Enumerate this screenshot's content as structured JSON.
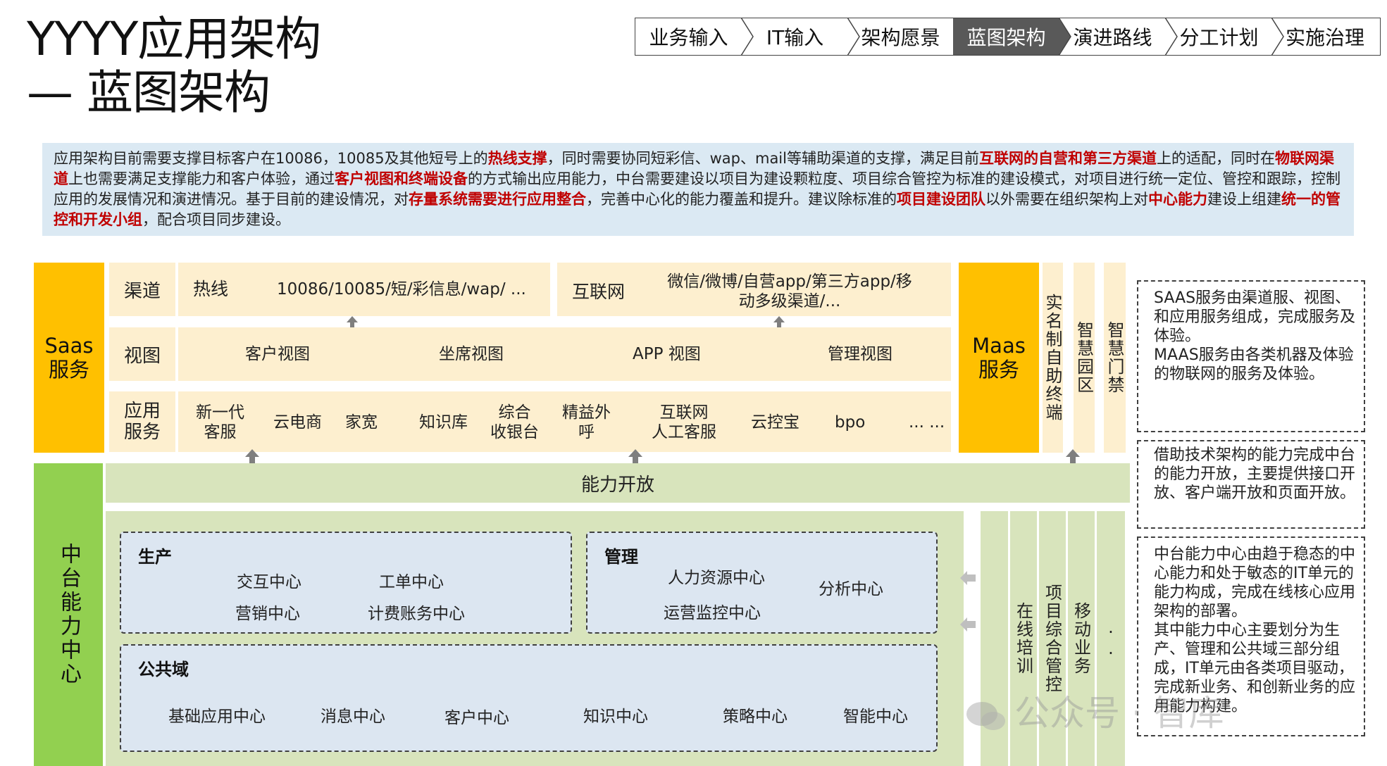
{
  "title": {
    "line1": "YYYY应用架构",
    "line2": "— 蓝图架构"
  },
  "breadcrumb": [
    "业务输入",
    "IT输入",
    "架构愿景",
    "蓝图架构",
    "演进路线",
    "分工计划",
    "实施治理"
  ],
  "intro": [
    {
      "t": "应用架构目前需要支撑目标客户在10086，10085及其他短号上的"
    },
    {
      "t": "热线支撑",
      "h": true
    },
    {
      "t": "，同时需要协同短彩信、wap、mail等辅助渠道的支撑，满足目前"
    },
    {
      "t": "互联网的自营和第三方渠道",
      "h": true
    },
    {
      "t": "上的适配，同时在"
    },
    {
      "t": "物联网渠道",
      "h": true
    },
    {
      "t": "上也需要满足支撑能力和客户体验，通过"
    },
    {
      "t": "客户视图和终端设备",
      "h": true
    },
    {
      "t": "的方式输出应用能力，中台需要建设以项目为建设颗粒度、项目综合管控为标准的建设模式，对项目进行统一定位、管控和跟踪，控制应用的发展情况和演进情况。基于目前的建设情况，对"
    },
    {
      "t": "存量系统需要进行应用整合",
      "h": true
    },
    {
      "t": "，完善中心化的能力覆盖和提升。建议除标准的"
    },
    {
      "t": "项目建设团队",
      "h": true
    },
    {
      "t": "以外需要在组织架构上对"
    },
    {
      "t": "中心能力",
      "h": true
    },
    {
      "t": "建设上组建"
    },
    {
      "t": "统一的管控和开发小组",
      "h": true
    },
    {
      "t": "，配合项目同步建设。"
    }
  ],
  "saas": {
    "label": "Saas\n服务",
    "row_channel": {
      "label": "渠道",
      "hotline": "热线",
      "hotline_detail": "10086/10085/短/彩信息/wap/ ...",
      "internet": "互联网",
      "internet_detail": "微信/微博/自营app/第三方app/移\n动多级渠道/..."
    },
    "row_view": {
      "label": "视图",
      "items": [
        "客户视图",
        "坐席视图",
        "APP 视图",
        "管理视图"
      ]
    },
    "row_app": {
      "label": "应用\n服务",
      "items": [
        "新一代\n客服",
        "云电商",
        "家宽",
        "知识库",
        "综合\n收银台",
        "精益外\n呼",
        "互联网\n人工客服",
        "云控宝",
        "bpo",
        "... ..."
      ]
    }
  },
  "maas": {
    "label": "Maas\n服务",
    "strips": [
      "实名制自助终端",
      "智慧园区",
      "智慧门禁"
    ]
  },
  "middle": {
    "label": "中台能力中心",
    "capability_open": "能力开放",
    "production": {
      "title": "生产",
      "items": [
        "交互中心",
        "工单中心",
        "营销中心",
        "计费账务中心"
      ]
    },
    "management": {
      "title": "管理",
      "items": [
        "人力资源中心",
        "分析中心",
        "运营监控中心"
      ]
    },
    "public": {
      "title": "公共域",
      "items": [
        "基础应用中心",
        "消息中心",
        "客户中心",
        "知识中心",
        "策略中心",
        "智能中心"
      ]
    },
    "right_strips": [
      "在线培训",
      "项目综合管控",
      "移动业务",
      ".."
    ]
  },
  "notes": [
    "SAAS服务由渠道服、视图、和应用服务组成，完成服务及体验。\nMAAS服务由各类机器及体验的物联网的服务及体验。",
    "借助技术架构的能力完成中台的能力开放，主要提供接口开放、客户端开放和页面开放。",
    "中台能力中心由趋于稳态的中心能力和处于敏态的IT单元的能力构成，完成在线核心应用架构的部署。\n其中能力中心主要划分为生产、管理和公共域三部分组成，IT单元由各类项目驱动，完成新业务、和创新业务的应用能力构建。"
  ],
  "watermark": "公众号 · 智库",
  "colors": {
    "saas_yellow": "#ffc000",
    "saas_light": "#fdefcf",
    "middle_green": "#92d050",
    "middle_pale": "#d8e4bc",
    "blue_box": "#dce6f1",
    "highlight_red": "#c00000",
    "active_crumb": "#595959"
  }
}
